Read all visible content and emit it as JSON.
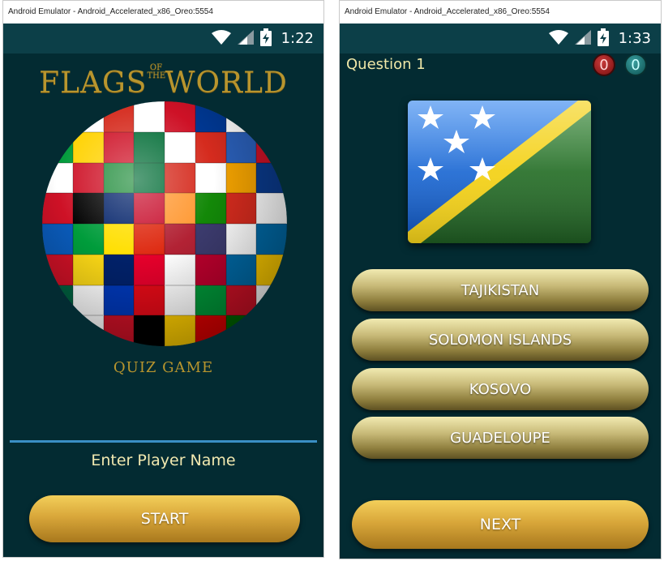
{
  "left_window": {
    "title": "Android Emulator - Android_Accelerated_x86_Oreo:5554",
    "status": {
      "time": "1:22",
      "wifi_icon": "wifi-icon",
      "signal_icon": "signal-icon",
      "battery_icon": "battery-charging-icon"
    },
    "logo": {
      "word1": "FLAGS",
      "small1": "OF",
      "small2": "THE",
      "word2": "WORLD"
    },
    "subtitle": "QUIZ GAME",
    "player_input": {
      "placeholder": "Enter Player Name",
      "value": ""
    },
    "start_label": "START"
  },
  "right_window": {
    "title": "Android Emulator - Android_Accelerated_x86_Oreo:5554",
    "status": {
      "time": "1:33",
      "wifi_icon": "wifi-icon",
      "signal_icon": "signal-icon",
      "battery_icon": "battery-charging-icon"
    },
    "question_title": "Question 1",
    "wrong_score": "0",
    "correct_score": "0",
    "answers": [
      "TAJIKISTAN",
      "SOLOMON ISLANDS",
      "KOSOVO",
      "GUADELOUPE"
    ],
    "next_label": "NEXT"
  },
  "colors": {
    "screen_bg": "#032b32",
    "statusbar_bg": "#0c3f48",
    "gold_text": "#b8952e",
    "cream_text": "#f0e8a8",
    "accent_line": "#3a8fc4"
  }
}
